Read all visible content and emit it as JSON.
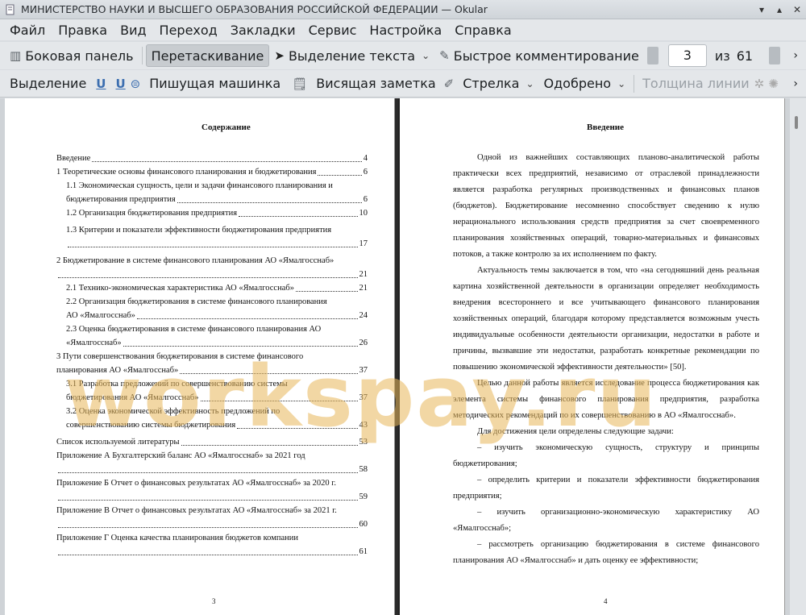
{
  "window": {
    "title": "МИНИСТЕРСТВО НАУКИ И ВЫСШЕГО ОБРАЗОВАНИЯ РОССИЙСКОЙ ФЕДЕРАЦИИ  — Okular",
    "menu": [
      "Файл",
      "Правка",
      "Вид",
      "Переход",
      "Закладки",
      "Сервис",
      "Настройка",
      "Справка"
    ]
  },
  "toolbar1": {
    "sidebar": "Боковая панель",
    "drag": "Перетаскивание",
    "select_text": "Выделение текста",
    "quick_comment": "Быстрое комментирование",
    "page_current": "3",
    "page_of": "из",
    "page_total": "61"
  },
  "toolbar2": {
    "selection": "Выделение",
    "typewriter": "Пишущая машинка",
    "note": "Висящая заметка",
    "arrow": "Стрелка",
    "approved": "Одобрено",
    "line_width": "Толщина линии"
  },
  "page3": {
    "title": "Содержание",
    "number": "3",
    "toc": [
      {
        "text": "Введение",
        "page": "4",
        "indent": false
      },
      {
        "text": "1 Теоретические основы финансового планирования и бюджетирования",
        "page": "6",
        "indent": false
      },
      {
        "text1": "1.1 Экономическая сущность, цели и задачи финансового планирования и",
        "text": "бюджетирования предприятия",
        "page": "6",
        "indent": true
      },
      {
        "text": "1.2 Организация бюджетирования предприятия",
        "page": "10",
        "indent": true
      },
      {
        "text1": "1.3 Критерии и показатели эффективности бюджетирования предприятия",
        "text": "",
        "page": "17",
        "indent": true
      },
      {
        "text1": "2 Бюджетирование в системе финансового планирования АО «Ямалгосснаб»",
        "text": "",
        "page": "21",
        "indent": false
      },
      {
        "text": "2.1 Технико-экономическая характеристика АО «Ямалгосснаб»",
        "page": "21",
        "indent": true
      },
      {
        "text1": "2.2 Организация бюджетирования в системе финансового планирования",
        "text": "АО «Ямалгосснаб»",
        "page": "24",
        "indent": true
      },
      {
        "text1": "2.3 Оценка бюджетирования в системе финансового планирования АО",
        "text": "«Ямалгосснаб»",
        "page": "26",
        "indent": true
      },
      {
        "text1": "3 Пути совершенствования бюджетирования в системе финансового",
        "text": "планирования АО «Ямалгосснаб»",
        "page": "37",
        "indent": false
      },
      {
        "text1": "3.1 Разработка предложений по совершенствованию системы",
        "text": "бюджетирования АО «Ямалгосснаб»",
        "page": "37",
        "indent": true
      },
      {
        "text1": "3.2 Оценка экономической эффективность предложений по",
        "text": "совершенствованию системы бюджетирования",
        "page": "43",
        "indent": true
      },
      {
        "text": "Список используемой литературы",
        "page": "53",
        "indent": false
      },
      {
        "text1": "Приложение А Бухгалтерский баланс АО «Ямалгосснаб» за 2021 год",
        "text": "",
        "page": "58",
        "indent": false
      },
      {
        "text1": "Приложение Б Отчет о финансовых результатах АО «Ямалгосснаб» за 2020 г.",
        "text": "",
        "page": "59",
        "indent": false
      },
      {
        "text1": "Приложение В Отчет о финансовых результатах АО «Ямалгосснаб» за 2021 г.",
        "text": "",
        "page": "60",
        "indent": false
      },
      {
        "text1": "Приложение Г Оценка качества планирования бюджетов компании",
        "text": "",
        "page": "61",
        "indent": false
      }
    ]
  },
  "page4": {
    "title": "Введение",
    "number": "4",
    "paragraphs": [
      "Одной из важнейших составляющих планово-аналитической работы практически всех предприятий, независимо от отраслевой принадлежности является разработка регулярных производственных и финансовых планов (бюджетов). Бюджетирование несомненно способствует сведению к нулю нерационального использования средств предприятия за счет своевременного планирования хозяйственных операций, товарно-материальных и финансовых потоков, а также контролю за их исполнением по факту.",
      "Актуальность темы заключается в том, что «на сегодняшний день реальная картина хозяйственной деятельности в организации определяет необходимость внедрения всестороннего и все учитывающего финансового планирования хозяйственных операций, благодаря которому представляется возможным учесть индивидуальные особенности деятельности организации, недостатки в работе и причины, вызвавшие эти недостатки, разработать конкретные рекомендации по повышению экономической эффективности деятельности» [50].",
      "Целью данной работы является исследование процесса бюджетирования как элемента системы финансового планирования предприятия, разработка методических рекомендаций по их совершенствованию в АО «Ямалгосснаб».",
      "Для достижения цели определены следующие задачи:",
      "– изучить экономическую сущность, структуру и принципы бюджетирования;",
      "– определить критерии и показатели эффективности бюджетирования предприятия;",
      "– изучить организационно-экономическую характеристику АО «Ямалгосснаб»;",
      "– рассмотреть организацию бюджетирования в системе финансового планирования АО «Ямалгосснаб» и дать оценку ее эффективности;"
    ]
  },
  "watermark": "workspay.ru"
}
